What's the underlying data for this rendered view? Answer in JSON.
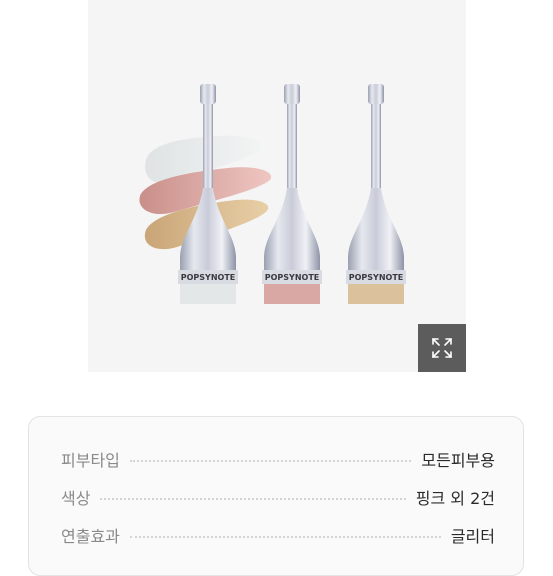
{
  "product_image": {
    "brand_text": "POPSYNOTE",
    "expand_icon": "expand-arrows-icon"
  },
  "info": {
    "rows": [
      {
        "label": "피부타입",
        "value": "모든피부용"
      },
      {
        "label": "색상",
        "value": "핑크 외 2건"
      },
      {
        "label": "연출효과",
        "value": "글리터"
      }
    ]
  }
}
